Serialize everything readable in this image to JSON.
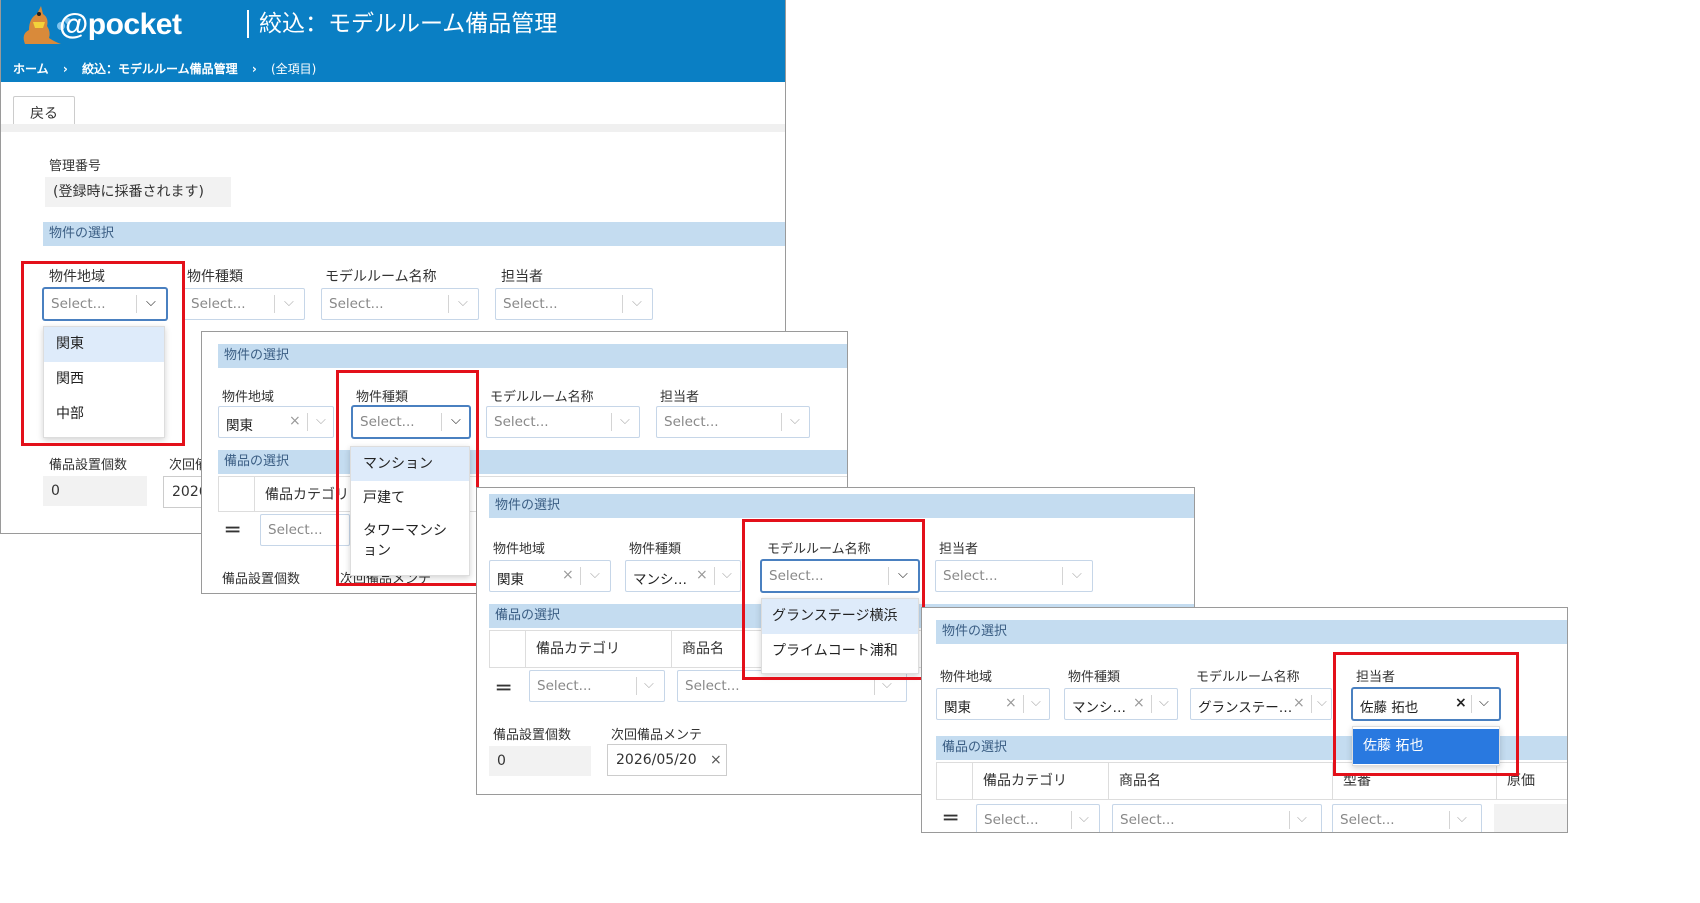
{
  "app": {
    "logo_text": "@pocket",
    "title": "絞込：モデルルーム備品管理"
  },
  "breadcrumb": [
    "ホーム",
    "›",
    "絞込：モデルルーム備品管理",
    "›",
    "(全項目)"
  ],
  "toolbar": {
    "back_label": "戻る"
  },
  "form": {
    "mgmt_label": "管理番号",
    "mgmt_value": "(登録時に採番されます)",
    "section_property": "物件の選択",
    "section_equipment": "備品の選択",
    "area_label": "物件地域",
    "type_label": "物件種類",
    "model_label": "モデルルーム名称",
    "owner_label": "担当者",
    "placeholder": "Select...",
    "count_label": "備品設置個数",
    "next_label": "次回備品メンテ",
    "next_label_short": "次回備",
    "count_value": "0",
    "date_value": "2026/05/20",
    "date_partial": "2026",
    "col_category": "備品カテゴリ",
    "col_category_short": "備品カテゴリ",
    "col_product": "商品名",
    "col_model": "型番",
    "col_cost": "原価"
  },
  "values": {
    "area": "関東",
    "type_trunc": "マンシ…",
    "model_trunc": "グランステー…",
    "owner": "佐藤 拓也"
  },
  "menus": {
    "area_options": [
      "関東",
      "関西",
      "中部"
    ],
    "type_options": [
      "マンション",
      "戸建て",
      "タワーマンション"
    ],
    "model_options": [
      "グランステージ横浜",
      "プライムコート浦和"
    ],
    "owner_options": [
      "佐藤 拓也"
    ]
  },
  "glyphs": {
    "clear": "×",
    "chevron": "⌵",
    "grip": "═"
  },
  "colors": {
    "header_bg": "#0a7fc4",
    "section_bg": "#c4dcf0",
    "highlight": "#e3101a",
    "option_selected": "#2979e0"
  }
}
